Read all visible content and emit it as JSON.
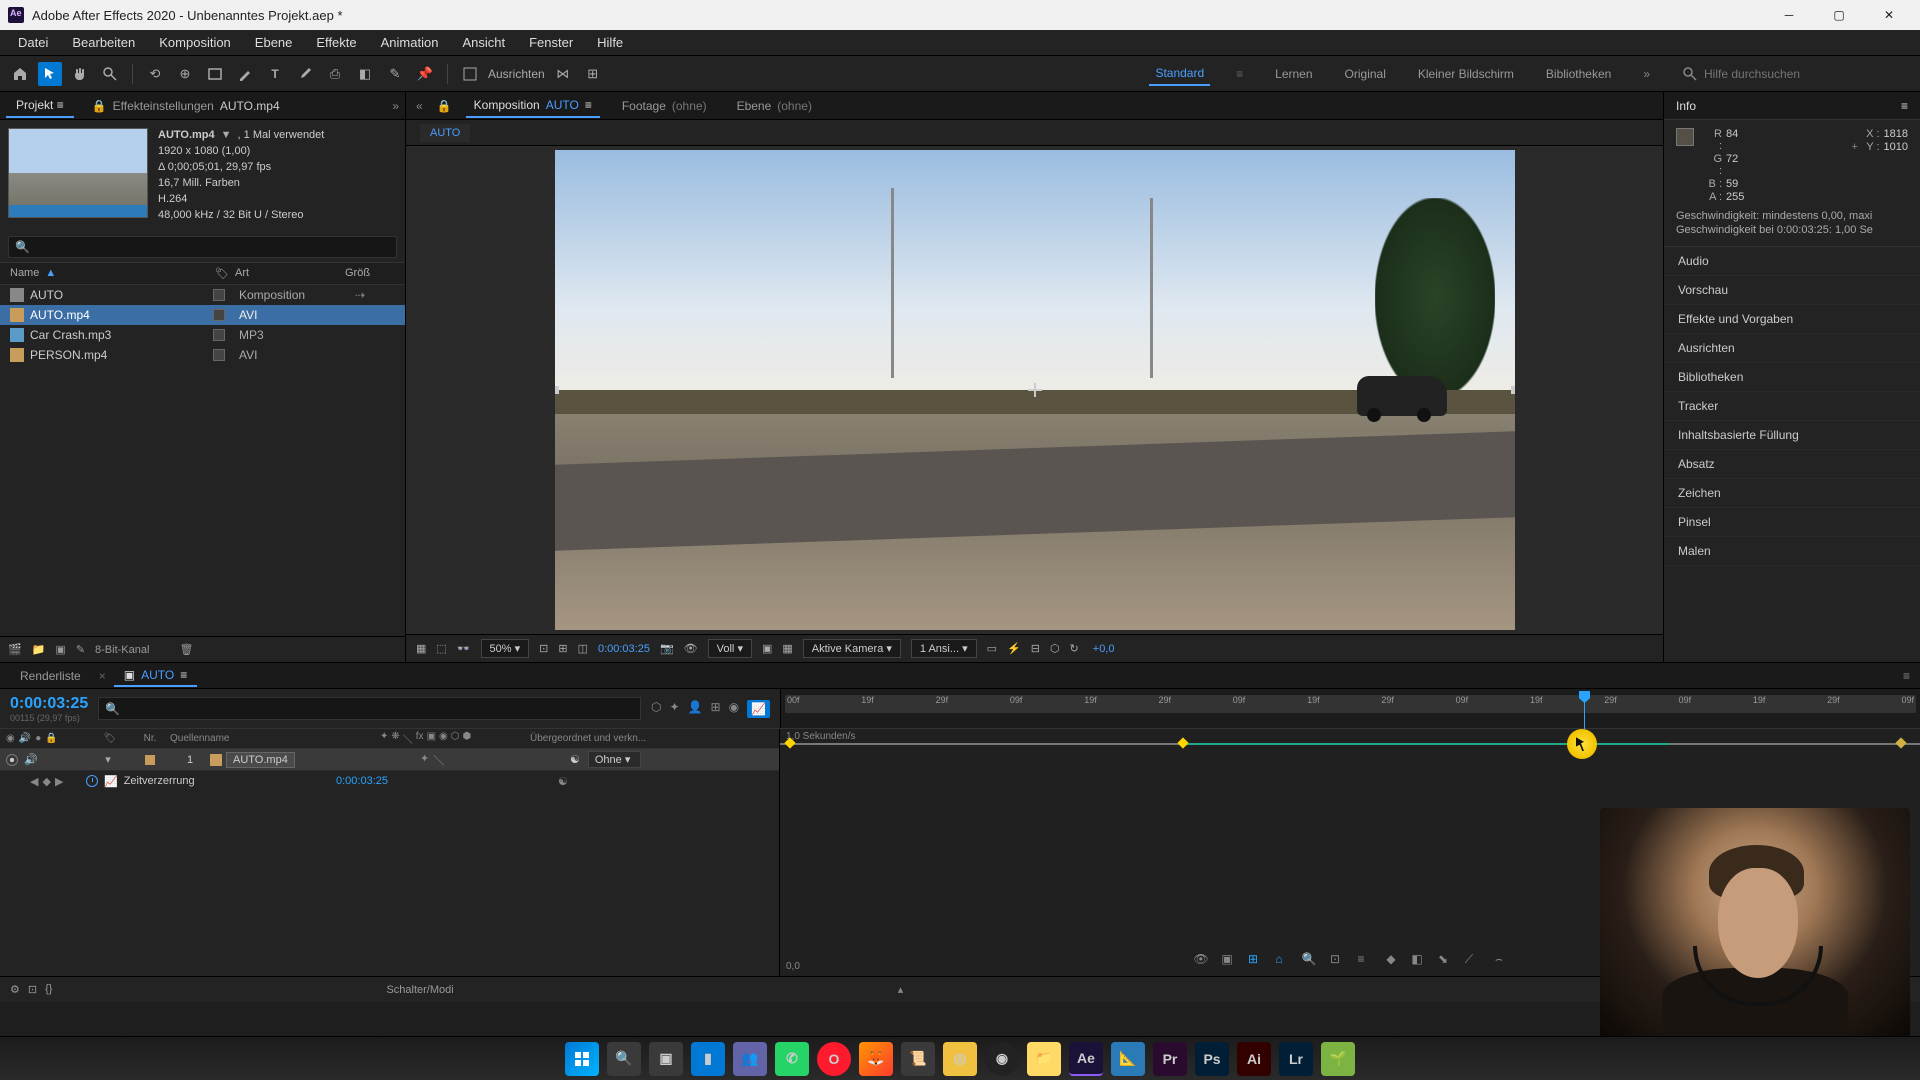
{
  "titlebar": {
    "app_icon": "ae-icon",
    "title": "Adobe After Effects 2020 - Unbenanntes Projekt.aep *"
  },
  "menu": [
    "Datei",
    "Bearbeiten",
    "Komposition",
    "Ebene",
    "Effekte",
    "Animation",
    "Ansicht",
    "Fenster",
    "Hilfe"
  ],
  "toolbar": {
    "align_label": "Ausrichten",
    "workspaces": [
      "Standard",
      "Lernen",
      "Original",
      "Kleiner Bildschirm",
      "Bibliotheken"
    ],
    "active_workspace": "Standard",
    "search_placeholder": "Hilfe durchsuchen"
  },
  "project_panel": {
    "tabs": {
      "project": "Projekt",
      "effect_settings": "Effekteinstellungen",
      "effect_target": "AUTO.mp4"
    },
    "asset": {
      "name": "AUTO.mp4",
      "usage": ", 1 Mal verwendet",
      "dims": "1920 x 1080 (1,00)",
      "dur_fps": "Δ 0;00;05;01, 29,97 fps",
      "colors": "16,7 Mill. Farben",
      "codec": "H.264",
      "audio": "48,000 kHz / 32 Bit U / Stereo"
    },
    "columns": {
      "name": "Name",
      "type": "Art",
      "size": "Größ"
    },
    "items": [
      {
        "name": "AUTO",
        "type": "Komposition",
        "icon": "comp"
      },
      {
        "name": "AUTO.mp4",
        "type": "AVI",
        "icon": "vid",
        "selected": true
      },
      {
        "name": "Car Crash.mp3",
        "type": "MP3",
        "icon": "mp3"
      },
      {
        "name": "PERSON.mp4",
        "type": "AVI",
        "icon": "vid"
      }
    ],
    "footer_depth": "8-Bit-Kanal"
  },
  "comp_panel": {
    "tab_label": "Komposition",
    "comp_name": "AUTO",
    "footage_label": "Footage",
    "footage_val": "(ohne)",
    "layer_label": "Ebene",
    "layer_val": "(ohne)",
    "footer": {
      "zoom": "50%",
      "time": "0:00:03:25",
      "res": "Voll",
      "camera": "Aktive Kamera",
      "views": "1 Ansi...",
      "exposure": "+0,0"
    }
  },
  "info_panel": {
    "title": "Info",
    "R": "84",
    "G": "72",
    "B": "59",
    "A": "255",
    "X": "1818",
    "Y": "1010",
    "speed1": "Geschwindigkeit: mindestens 0,00, maxi",
    "speed2": "Geschwindigkeit bei 0:00:03:25: 1,00 Se"
  },
  "right_stack": [
    "Audio",
    "Vorschau",
    "Effekte und Vorgaben",
    "Ausrichten",
    "Bibliotheken",
    "Tracker",
    "Inhaltsbasierte Füllung",
    "Absatz",
    "Zeichen",
    "Pinsel",
    "Malen"
  ],
  "timeline": {
    "tabs": {
      "render": "Renderliste",
      "comp": "AUTO"
    },
    "current_time": "0:00:03:25",
    "subtime": "00115 (29,97 fps)",
    "col_nr": "Nr.",
    "col_src": "Quellenname",
    "col_parent": "Übergeordnet und verkn...",
    "layer": {
      "num": "1",
      "name": "AUTO.mp4",
      "parent": "Ohne"
    },
    "prop": {
      "name": "Zeitverzerrung",
      "value": "0:00:03:25"
    },
    "ruler": [
      "00f",
      "19f",
      "29f",
      "09f",
      "19f",
      "29f",
      "09f",
      "19f",
      "29f",
      "09f",
      "19f",
      "29f",
      "09f",
      "19f",
      "29f",
      "09f"
    ],
    "graph_top": "1,0 Sekunden/s",
    "graph_bot": "0,0",
    "footer_label": "Schalter/Modi"
  },
  "taskbar": {
    "apps": [
      "windows",
      "search",
      "taskview",
      "edge",
      "teams",
      "whatsapp",
      "opera",
      "firefox",
      "app1",
      "app2",
      "obs",
      "explorer",
      "ae",
      "app3",
      "pr",
      "ps",
      "ai",
      "lr",
      "app4"
    ]
  }
}
